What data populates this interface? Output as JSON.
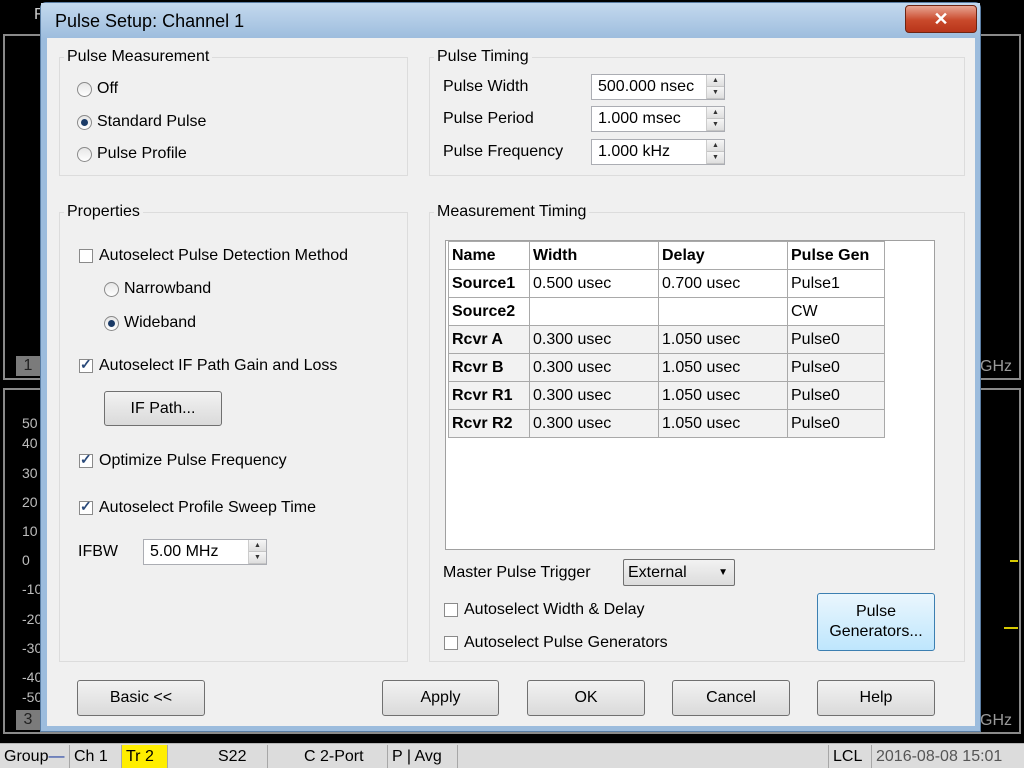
{
  "background": {
    "title_left": "F",
    "window_num_top": "1",
    "window_num_bottom": "3",
    "ghz_top": "GHz",
    "ghz_bottom": "GHz",
    "y_labels": [
      "50",
      "40",
      "30",
      "20",
      "10",
      "0",
      "-10",
      "-20",
      "-30",
      "-40",
      "-50"
    ]
  },
  "status_bar": {
    "group": "Group",
    "channel": "Ch 1",
    "trace": "Tr 2",
    "param": "S22",
    "cal": "C  2-Port",
    "mode": "P | Avg",
    "lcl": "LCL",
    "datetime": "2016-08-08 15:01"
  },
  "dialog": {
    "title": "Pulse Setup: Channel 1",
    "close_label": "✕",
    "pulse_measurement": {
      "label": "Pulse Measurement",
      "options": [
        "Off",
        "Standard Pulse",
        "Pulse Profile"
      ],
      "selected": "Standard Pulse"
    },
    "pulse_timing": {
      "label": "Pulse Timing",
      "width_label": "Pulse Width",
      "width_value": "500.000 nsec",
      "period_label": "Pulse Period",
      "period_value": "1.000 msec",
      "freq_label": "Pulse Frequency",
      "freq_value": "1.000 kHz"
    },
    "properties": {
      "label": "Properties",
      "autoselect_detection": "Autoselect Pulse Detection Method",
      "narrowband": "Narrowband",
      "wideband": "Wideband",
      "autoselect_if_path": "Autoselect IF Path Gain and Loss",
      "if_path_button": "IF Path...",
      "optimize_freq": "Optimize Pulse Frequency",
      "autoselect_sweep": "Autoselect Profile Sweep Time",
      "ifbw_label": "IFBW",
      "ifbw_value": "5.00 MHz"
    },
    "measurement_timing": {
      "label": "Measurement Timing",
      "columns": [
        "Name",
        "Width",
        "Delay",
        "Pulse Gen"
      ],
      "rows": [
        [
          "Source1",
          "0.500 usec",
          "0.700 usec",
          "Pulse1"
        ],
        [
          "Source2",
          "",
          "",
          "CW"
        ],
        [
          "Rcvr A",
          "0.300 usec",
          "1.050 usec",
          "Pulse0"
        ],
        [
          "Rcvr B",
          "0.300 usec",
          "1.050 usec",
          "Pulse0"
        ],
        [
          "Rcvr R1",
          "0.300 usec",
          "1.050 usec",
          "Pulse0"
        ],
        [
          "Rcvr R2",
          "0.300 usec",
          "1.050 usec",
          "Pulse0"
        ]
      ],
      "trigger_label": "Master Pulse Trigger",
      "trigger_value": "External",
      "autoselect_width_delay": "Autoselect Width & Delay",
      "autoselect_generators": "Autoselect Pulse Generators",
      "pulse_generators_line1": "Pulse",
      "pulse_generators_line2": "Generators..."
    },
    "buttons": {
      "basic": "Basic <<",
      "apply": "Apply",
      "ok": "OK",
      "cancel": "Cancel",
      "help": "Help"
    }
  }
}
